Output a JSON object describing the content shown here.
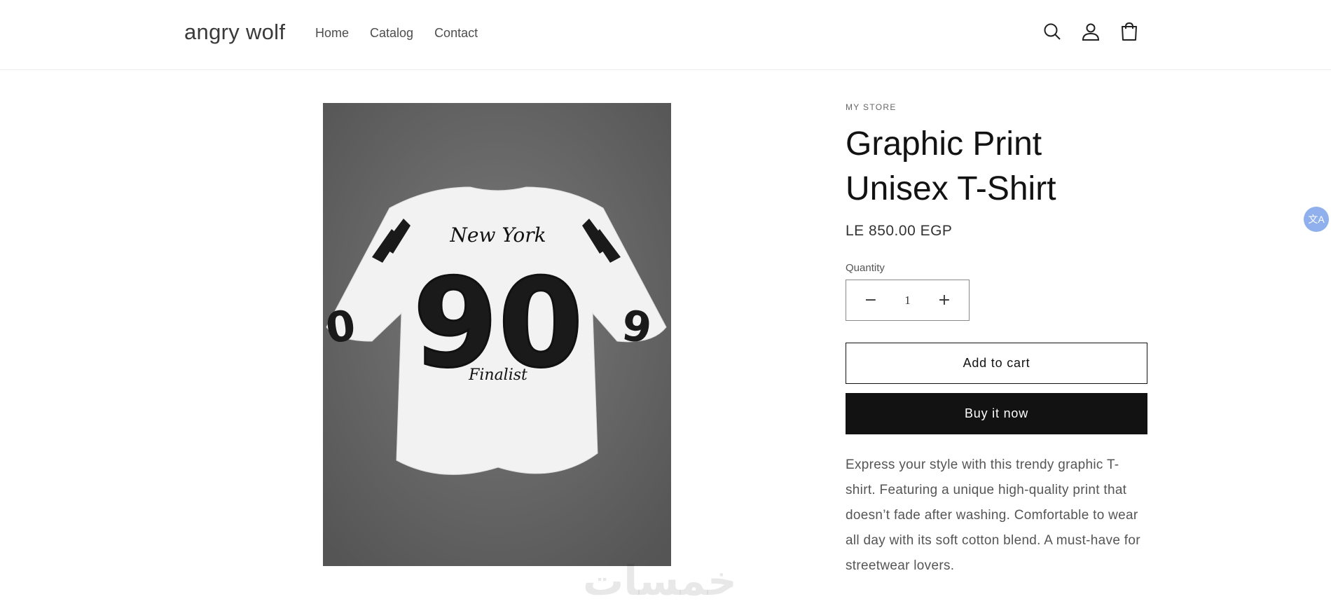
{
  "header": {
    "logo": "angry wolf",
    "nav": [
      "Home",
      "Catalog",
      "Contact"
    ],
    "icons": [
      "search-icon",
      "account-icon",
      "cart-icon"
    ]
  },
  "product": {
    "vendor": "MY STORE",
    "title": "Graphic Print Unisex T-Shirt",
    "price": "LE 850.00 EGP",
    "quantity_label": "Quantity",
    "quantity_value": "1",
    "add_to_cart": "Add to cart",
    "buy_now": "Buy it now",
    "description": "Express your style with this trendy graphic T-shirt. Featuring a unique high-quality print that doesn’t fade after washing. Comfortable to wear all day with its soft cotton blend. A must-have for streetwear lovers.",
    "image": {
      "print_top": "New York",
      "print_number": "90",
      "print_bottom": "Finalist"
    }
  },
  "translate_widget": "文A",
  "watermark": "خمسات"
}
